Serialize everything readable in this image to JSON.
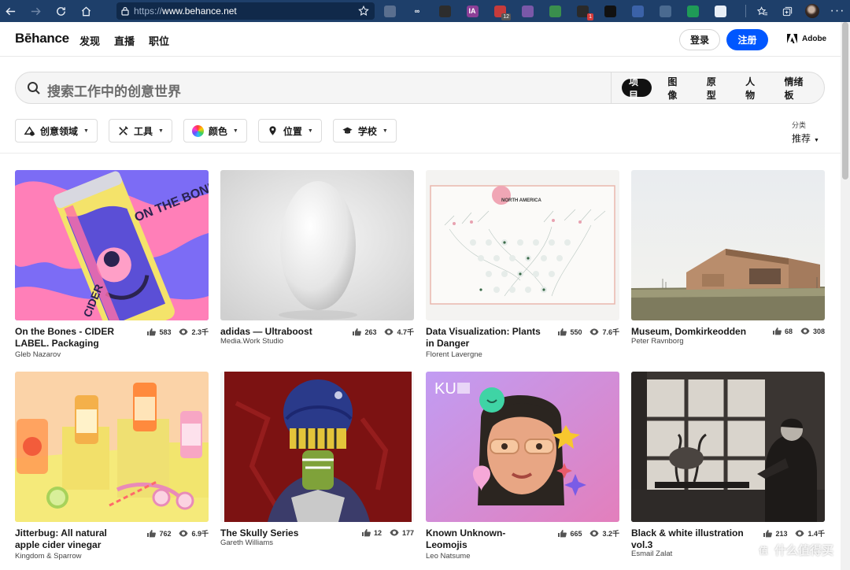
{
  "browser": {
    "url_protocol": "https://",
    "url_host": "www.behance.net",
    "extensions": [
      {
        "icon": "ext-hand-icon",
        "color": "#5a6f8f",
        "text": "",
        "badge": ""
      },
      {
        "icon": "ext-infinity-icon",
        "color": "#1e3f6a",
        "text": "∞",
        "badge": ""
      },
      {
        "icon": "ext-camera-icon",
        "color": "#2d2d2d",
        "text": "",
        "badge": ""
      },
      {
        "icon": "ext-ia-icon",
        "color": "#8c3f97",
        "text": "IA",
        "badge": ""
      },
      {
        "icon": "ext-clip-icon",
        "color": "#c63b3b",
        "text": "",
        "badge": "12"
      },
      {
        "icon": "ext-cat-icon",
        "color": "#7a58a8",
        "text": "",
        "badge": ""
      },
      {
        "icon": "ext-leaf-icon",
        "color": "#3a8f4d",
        "text": "",
        "badge": ""
      },
      {
        "icon": "ext-mail-icon",
        "color": "#2a2a2a",
        "text": "",
        "badge": "1"
      },
      {
        "icon": "ext-reader-icon",
        "color": "#111111",
        "text": "",
        "badge": ""
      },
      {
        "icon": "ext-copy-icon",
        "color": "#3b62a8",
        "text": "",
        "badge": ""
      },
      {
        "icon": "ext-shield-icon",
        "color": "#4a6a90",
        "text": "",
        "badge": ""
      },
      {
        "icon": "ext-green-icon",
        "color": "#1f9b57",
        "text": "",
        "badge": ""
      },
      {
        "icon": "ext-puzzle-icon",
        "color": "#e8eef6",
        "text": "",
        "badge": ""
      }
    ]
  },
  "header": {
    "logo": "Bēhance",
    "nav": [
      "发现",
      "直播",
      "职位"
    ],
    "login": "登录",
    "signup": "注册",
    "adobe": "Adobe"
  },
  "search": {
    "placeholder": "搜索工作中的创意世界",
    "tabs": [
      "项目",
      "图像",
      "原型",
      "人物",
      "情绪板"
    ],
    "active_tab": 0
  },
  "filters": [
    {
      "icon": "creative-field-icon",
      "label": "创意领域"
    },
    {
      "icon": "tools-icon",
      "label": "工具"
    },
    {
      "icon": "color-wheel-icon",
      "label": "颜色"
    },
    {
      "icon": "location-pin-icon",
      "label": "位置"
    },
    {
      "icon": "school-cap-icon",
      "label": "学校"
    }
  ],
  "sort": {
    "label": "分类",
    "value": "推荐"
  },
  "projects": [
    {
      "title": "On the Bones - CIDER LABEL. Packaging",
      "owner": "Gleb Nazarov",
      "likes": "583",
      "views": "2.3千"
    },
    {
      "title": "adidas — Ultraboost",
      "owner": "Media.Work Studio",
      "likes": "263",
      "views": "4.7千"
    },
    {
      "title": "Data Visualization: Plants in Danger",
      "owner": "Florent Lavergne",
      "likes": "550",
      "views": "7.6千"
    },
    {
      "title": "Museum, Domkirkeodden",
      "owner": "Peter Ravnborg",
      "likes": "68",
      "views": "308"
    },
    {
      "title": "Jitterbug: All natural apple cider vinegar",
      "owner": "Kingdom & Sparrow",
      "likes": "762",
      "views": "6.9千"
    },
    {
      "title": "The Skully Series",
      "owner": "Gareth Williams",
      "likes": "12",
      "views": "177"
    },
    {
      "title": "Known Unknown- Leomojis",
      "owner": "Leo Natsume",
      "likes": "665",
      "views": "3.2千"
    },
    {
      "title": "Black & white illustration vol.3",
      "owner": "Esmail Zalat",
      "likes": "213",
      "views": "1.4千"
    }
  ],
  "thumb_text": {
    "bones_can": "ON THE BONE",
    "bones_side": "CIDER",
    "dataviz_heading": "NORTH AMERICA",
    "ku": "KU"
  },
  "watermark": "什么值得买"
}
